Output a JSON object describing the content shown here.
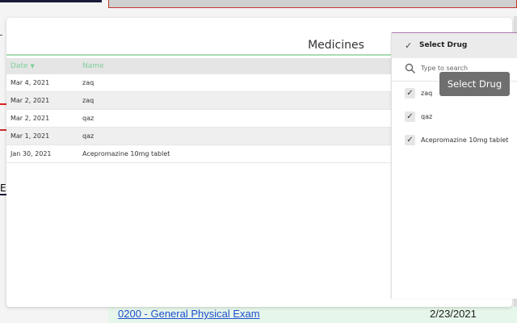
{
  "card": {
    "title": "Medicines"
  },
  "table": {
    "headers": {
      "date": "Date",
      "name": "Name"
    },
    "sort_icon": "sort-down-icon",
    "rows": [
      {
        "date": "Mar 4, 2021",
        "name": "zaq"
      },
      {
        "date": "Mar 2, 2021",
        "name": "zaq"
      },
      {
        "date": "Mar 2, 2021",
        "name": "qaz"
      },
      {
        "date": "Mar 1, 2021",
        "name": "qaz"
      },
      {
        "date": "Jan 30, 2021",
        "name": "Acepromazine 10mg tablet"
      }
    ]
  },
  "drug_panel": {
    "title": "Select Drug",
    "search_placeholder": "Type to search",
    "options": [
      {
        "label": "zaq",
        "checked": true
      },
      {
        "label": "qaz",
        "checked": true
      },
      {
        "label": "Acepromazine 10mg tablet",
        "checked": true
      }
    ]
  },
  "tooltip": {
    "text": "Select Drug"
  },
  "background": {
    "left_char": "E",
    "exam_link": "0200 - General Physical Exam",
    "exam_date": "2/23/2021"
  },
  "colors": {
    "accent_green": "#7ed09a",
    "link_blue": "#1d4fd1",
    "tooltip_bg": "#6f6f6f"
  }
}
